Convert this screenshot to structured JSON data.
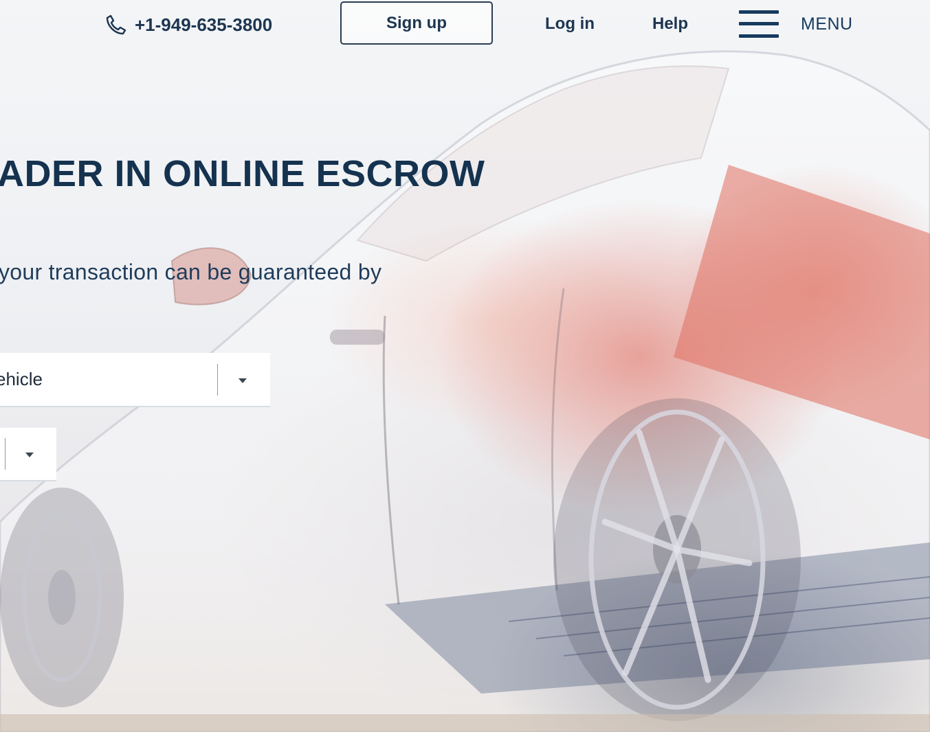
{
  "header": {
    "phone": "+1-949-635-3800",
    "signup_label": "Sign up",
    "login_label": "Log in",
    "help_label": "Help",
    "menu_label": "MENU"
  },
  "hero": {
    "headline": "ADER IN ONLINE ESCROW",
    "subtext": "your transaction can be guaranteed by"
  },
  "form": {
    "category_select_value": "ehicle",
    "second_select_value": ""
  },
  "icons": [
    "phone-icon",
    "hamburger-menu-icon",
    "chevron-down-icon"
  ],
  "colors": {
    "navy_text": "#15324f",
    "nav_text": "#1d3550",
    "hamburger": "#173a5e",
    "button_border": "#2a3d52"
  }
}
